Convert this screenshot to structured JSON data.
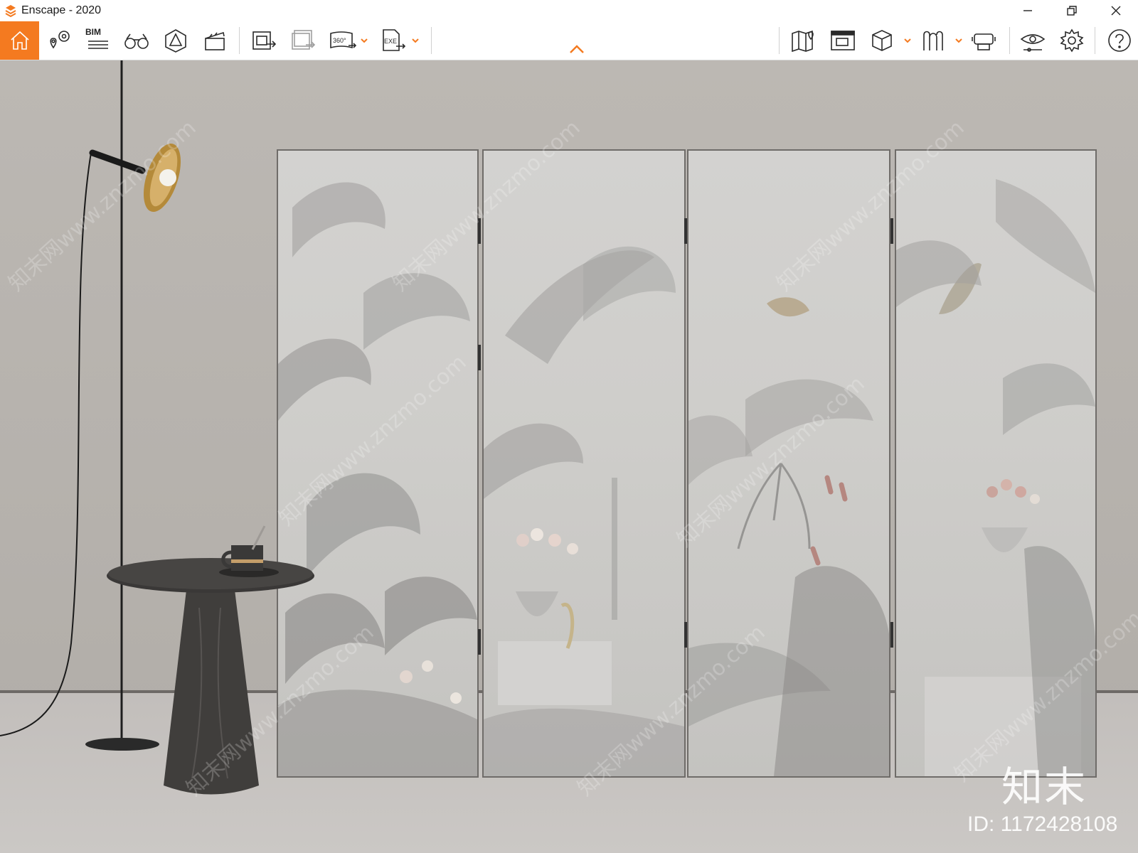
{
  "window": {
    "title": "Enscape - 2020",
    "controls": [
      "minimize",
      "restore",
      "close"
    ]
  },
  "toolbar": {
    "accent_color": "#f47a20",
    "left_tools": [
      {
        "name": "home-icon",
        "active": true
      },
      {
        "name": "sync-location-icon"
      },
      {
        "name": "bim-icon",
        "label": "BIM"
      },
      {
        "name": "binoculars-icon"
      },
      {
        "name": "asset-library-icon"
      },
      {
        "name": "video-clapper-icon"
      },
      {
        "name": "export-image-icon"
      },
      {
        "name": "batch-render-icon"
      },
      {
        "name": "panorama-360-icon",
        "label": "360°"
      },
      {
        "name": "export-exe-icon",
        "label": "EXE"
      }
    ],
    "right_tools": [
      {
        "name": "map-icon"
      },
      {
        "name": "view-management-icon"
      },
      {
        "name": "cube-icon"
      },
      {
        "name": "sculpture-icon"
      },
      {
        "name": "vr-headset-icon"
      },
      {
        "name": "visual-settings-icon"
      },
      {
        "name": "settings-gear-icon"
      },
      {
        "name": "help-icon"
      }
    ]
  },
  "viewport": {
    "watermark": {
      "logo_text": "知末",
      "id_text": "ID: 1172428108",
      "diagonal_text": "知末网www.znzmo.com"
    }
  }
}
